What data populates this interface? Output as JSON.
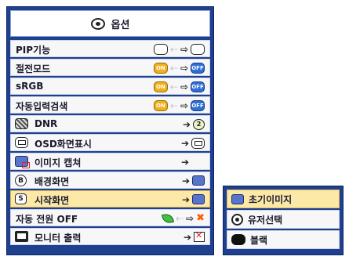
{
  "menu": {
    "title": "옵션",
    "title_icon": "options-icon",
    "rows": [
      {
        "label": "PIP기능",
        "icon": "",
        "control": "empty-to-empty"
      },
      {
        "label": "절전모드",
        "icon": "",
        "control": "on-to-off"
      },
      {
        "label": "sRGB",
        "icon": "",
        "control": "on-to-off"
      },
      {
        "label": "자동입력검색",
        "icon": "",
        "control": "on-to-off"
      },
      {
        "label": "DNR",
        "icon": "dnr-icon",
        "control": "to-2",
        "value": "2"
      },
      {
        "label": "OSD화면표시",
        "icon": "osd-icon",
        "control": "to-osd"
      },
      {
        "label": "이미지 캡쳐",
        "icon": "capture-icon",
        "control": "arrow-only"
      },
      {
        "label": "배경화면",
        "icon": "background-b-icon",
        "control": "to-image"
      },
      {
        "label": "시작화면",
        "icon": "startup-s-icon",
        "control": "to-image",
        "highlight": true
      },
      {
        "label": "자동 전원 OFF",
        "icon": "",
        "control": "leaf-to-x"
      },
      {
        "label": "모니터 출력",
        "icon": "monitor-icon",
        "control": "to-x-box"
      }
    ]
  },
  "submenu": {
    "items": [
      {
        "label": "초기이미지",
        "icon": "default-image-icon",
        "highlight": true
      },
      {
        "label": "유저선택",
        "icon": "user-select-icon"
      },
      {
        "label": "블랙",
        "icon": "black-icon"
      }
    ]
  },
  "pill_text": {
    "on": "ON",
    "off": "OFF"
  },
  "colors": {
    "panel": "#1f3f8f",
    "highlight": "#fde9a7",
    "on": "#f1b01c",
    "off": "#2e6fd6"
  }
}
